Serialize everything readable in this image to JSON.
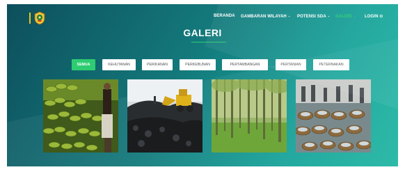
{
  "nav": {
    "items": [
      {
        "label": "BERANDA",
        "dropdown": false,
        "active": false
      },
      {
        "label": "GAMBARAN WILAYAH",
        "dropdown": true,
        "active": false
      },
      {
        "label": "POTENSI SDA",
        "dropdown": true,
        "active": false
      },
      {
        "label": "GALERI",
        "dropdown": true,
        "active": true
      },
      {
        "label": "LOGIN",
        "dropdown": false,
        "active": false
      }
    ],
    "caret": "⌄",
    "login_icon": "⊙"
  },
  "page": {
    "title": "GALERI"
  },
  "filters": [
    {
      "label": "SEMUA",
      "active": true
    },
    {
      "label": "KEHUTANAN",
      "active": false
    },
    {
      "label": "PERIKANAN",
      "active": false
    },
    {
      "label": "PERKEBUNAN",
      "active": false
    },
    {
      "label": "PERTAMBANGAN",
      "active": false
    },
    {
      "label": "PERTANIAN",
      "active": false
    },
    {
      "label": "PETERNAKAN",
      "active": false
    }
  ],
  "gallery": [
    {
      "name": "banana-harvest-photo",
      "subject": "bananas"
    },
    {
      "name": "coal-excavator-photo",
      "subject": "coal mining"
    },
    {
      "name": "forest-plantation-photo",
      "subject": "tree plantation"
    },
    {
      "name": "fish-market-photo",
      "subject": "fish baskets"
    }
  ],
  "colors": {
    "accent": "#2ecc71",
    "bg_dark": "#0d4f5c",
    "bg_light": "#22b7a4",
    "logo_bar": "#e8c21f"
  }
}
